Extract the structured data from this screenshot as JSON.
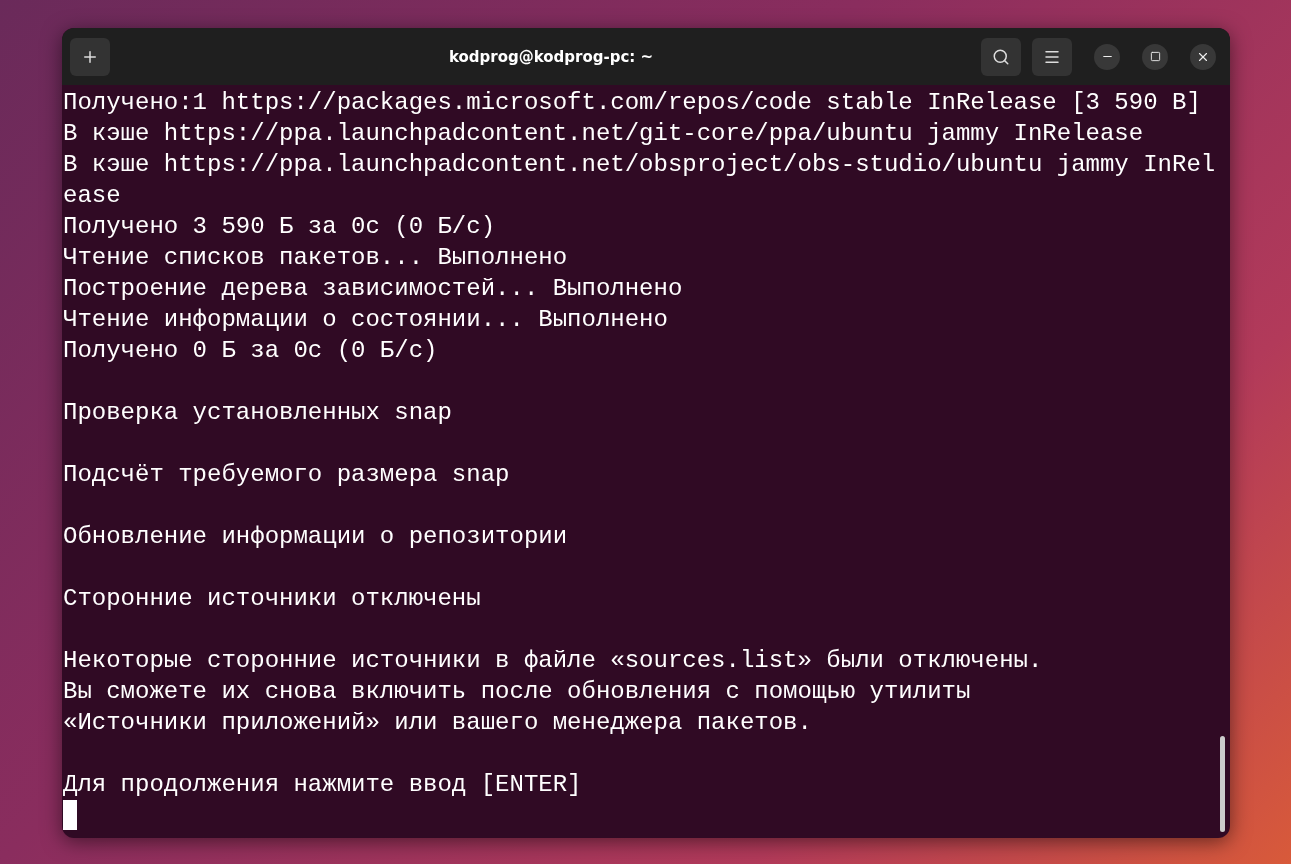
{
  "window": {
    "title": "kodprog@kodprog-pc: ~"
  },
  "terminal": {
    "lines": [
      {
        "kind": "text",
        "text": "Получено:1 https://packages.microsoft.com/repos/code stable InRelease [3 590 B]"
      },
      {
        "kind": "text",
        "text": "В кэше https://ppa.launchpadcontent.net/git-core/ppa/ubuntu jammy InRelease"
      },
      {
        "kind": "text",
        "text": "В кэше https://ppa.launchpadcontent.net/obsproject/obs-studio/ubuntu jammy InRel"
      },
      {
        "kind": "text",
        "text": "ease"
      },
      {
        "kind": "text",
        "text": "Получено 3 590 Б за 0с (0 Б/с)"
      },
      {
        "kind": "text",
        "text": "Чтение списков пакетов... Выполнено"
      },
      {
        "kind": "text",
        "text": "Построение дерева зависимостей... Выполнено"
      },
      {
        "kind": "text",
        "text": "Чтение информации о состоянии... Выполнено"
      },
      {
        "kind": "text",
        "text": "Получено 0 Б за 0с (0 Б/с)"
      },
      {
        "kind": "blank"
      },
      {
        "kind": "text",
        "text": "Проверка установленных snap"
      },
      {
        "kind": "blank"
      },
      {
        "kind": "text",
        "text": "Подсчёт требуемого размера snap"
      },
      {
        "kind": "blank"
      },
      {
        "kind": "text",
        "text": "Обновление информации о репозитории"
      },
      {
        "kind": "blank"
      },
      {
        "kind": "text",
        "text": "Сторонние источники отключены"
      },
      {
        "kind": "blank"
      },
      {
        "kind": "text",
        "text": "Некоторые сторонние источники в файле «sources.list» были отключены."
      },
      {
        "kind": "text",
        "text": "Вы сможете их снова включить после обновления с помощью утилиты"
      },
      {
        "kind": "text",
        "text": "«Источники приложений» или вашего менеджера пакетов."
      },
      {
        "kind": "blank"
      },
      {
        "kind": "text",
        "text": "Для продолжения нажмите ввод [ENTER]"
      },
      {
        "kind": "cursor"
      }
    ]
  }
}
